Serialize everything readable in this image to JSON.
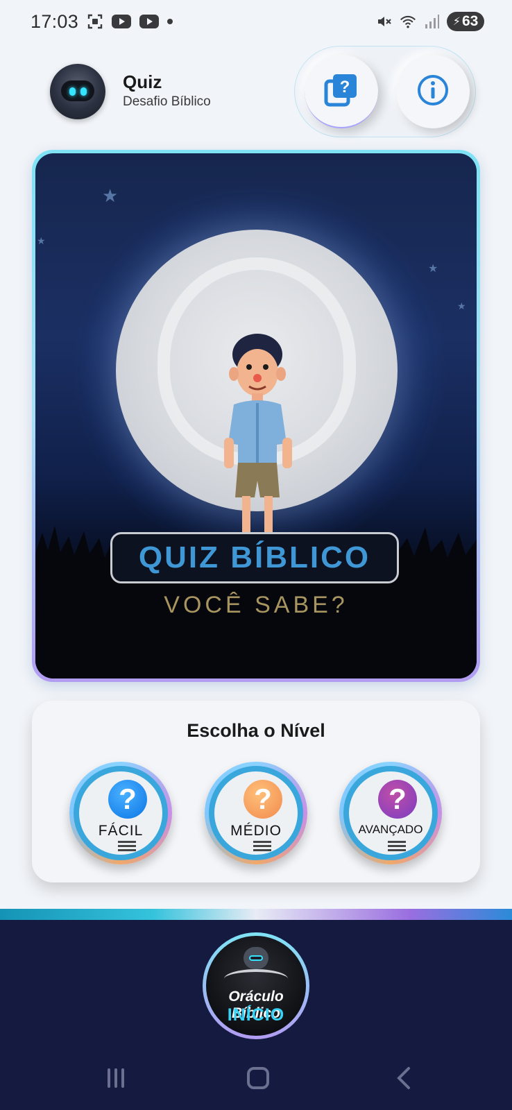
{
  "status_bar": {
    "time": "17:03",
    "battery": "63",
    "icons": [
      "screenshot-icon",
      "youtube-icon",
      "youtube-icon",
      "notification-dot-icon",
      "mute-icon",
      "wifi-icon",
      "signal-icon",
      "battery-charging-icon"
    ]
  },
  "header": {
    "title": "Quiz",
    "subtitle": "Desafio Bíblico",
    "actions": [
      "quiz-icon",
      "info-icon"
    ]
  },
  "hero": {
    "title": "QUIZ BÍBLICO",
    "subtitle": "VOCÊ SABE?"
  },
  "levels": {
    "heading": "Escolha o Nível",
    "items": [
      {
        "label": "FÁCIL",
        "icon": "question-icon",
        "color": "#0a74e6"
      },
      {
        "label": "MÉDIO",
        "icon": "question-icon",
        "color": "#f18a4d"
      },
      {
        "label": "AVANÇADO",
        "icon": "question-icon",
        "color": "#7a3cc2"
      }
    ]
  },
  "bottom_nav": {
    "home_title": "Oráculo Bíblico",
    "home_sub": "INÍCIO"
  },
  "system_nav": [
    "recent-apps-icon",
    "home-icon",
    "back-icon"
  ],
  "colors": {
    "accent": "#3aa7dc",
    "nav_bg": "#141a40",
    "page_bg": "#f1f4f8"
  }
}
